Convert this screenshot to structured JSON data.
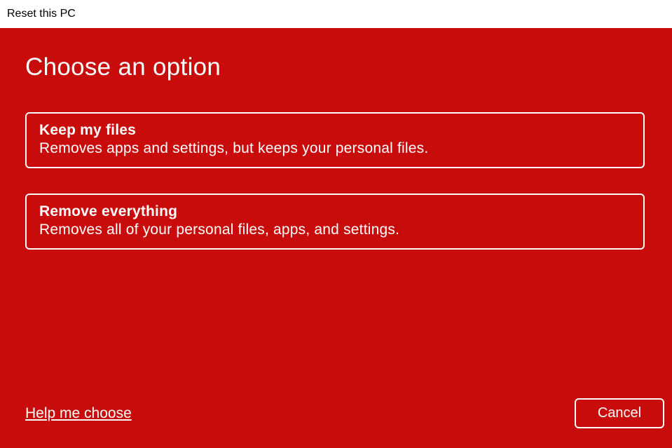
{
  "window": {
    "title": "Reset this PC"
  },
  "main": {
    "heading": "Choose an option",
    "options": [
      {
        "title": "Keep my files",
        "description": "Removes apps and settings, but keeps your personal files."
      },
      {
        "title": "Remove everything",
        "description": "Removes all of your personal files, apps, and settings."
      }
    ]
  },
  "footer": {
    "help_link": "Help me choose",
    "cancel_label": "Cancel"
  }
}
